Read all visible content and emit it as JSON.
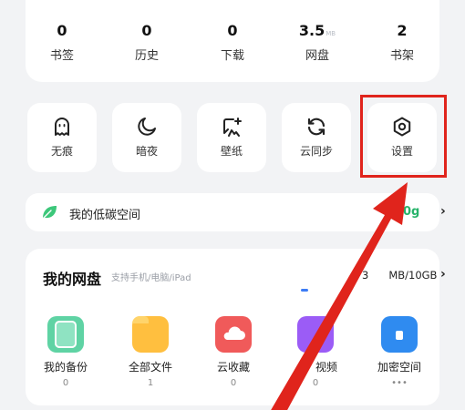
{
  "stats": [
    {
      "value": "0",
      "label": "书签"
    },
    {
      "value": "0",
      "label": "历史"
    },
    {
      "value": "0",
      "label": "下载"
    },
    {
      "value": "3.5",
      "unit": "MB",
      "label": "网盘"
    },
    {
      "value": "2",
      "label": "书架"
    }
  ],
  "tools": [
    {
      "label": "无痕",
      "icon": "ghost-icon"
    },
    {
      "label": "暗夜",
      "icon": "moon-icon"
    },
    {
      "label": "壁纸",
      "icon": "wallpaper-icon"
    },
    {
      "label": "云同步",
      "icon": "sync-icon"
    },
    {
      "label": "设置",
      "icon": "settings-hexagon-icon"
    }
  ],
  "carbon": {
    "title": "我的低碳空间",
    "value": "+10",
    "unit_suffix": "g",
    "chevron": "›"
  },
  "drive": {
    "title": "我的网盘",
    "subtitle": "支持手机/电脑/iPad",
    "capacity_left": "3",
    "capacity_right": "MB/10GB",
    "items": [
      {
        "label": "我的备份",
        "count": "0",
        "color": "#5fd3a4"
      },
      {
        "label": "全部文件",
        "count": "1",
        "color": "#ffbf3f"
      },
      {
        "label": "云收藏",
        "count": "0",
        "color": "#f05a5a"
      },
      {
        "label": "视频",
        "count": "0",
        "color": "#9b5cf6"
      },
      {
        "label": "加密空间",
        "count": "•••",
        "color": "#2f8bf0"
      }
    ]
  },
  "colors": {
    "accent_red": "#e0241c",
    "carbon_green": "#27b36a",
    "background": "#f2f3f5"
  }
}
